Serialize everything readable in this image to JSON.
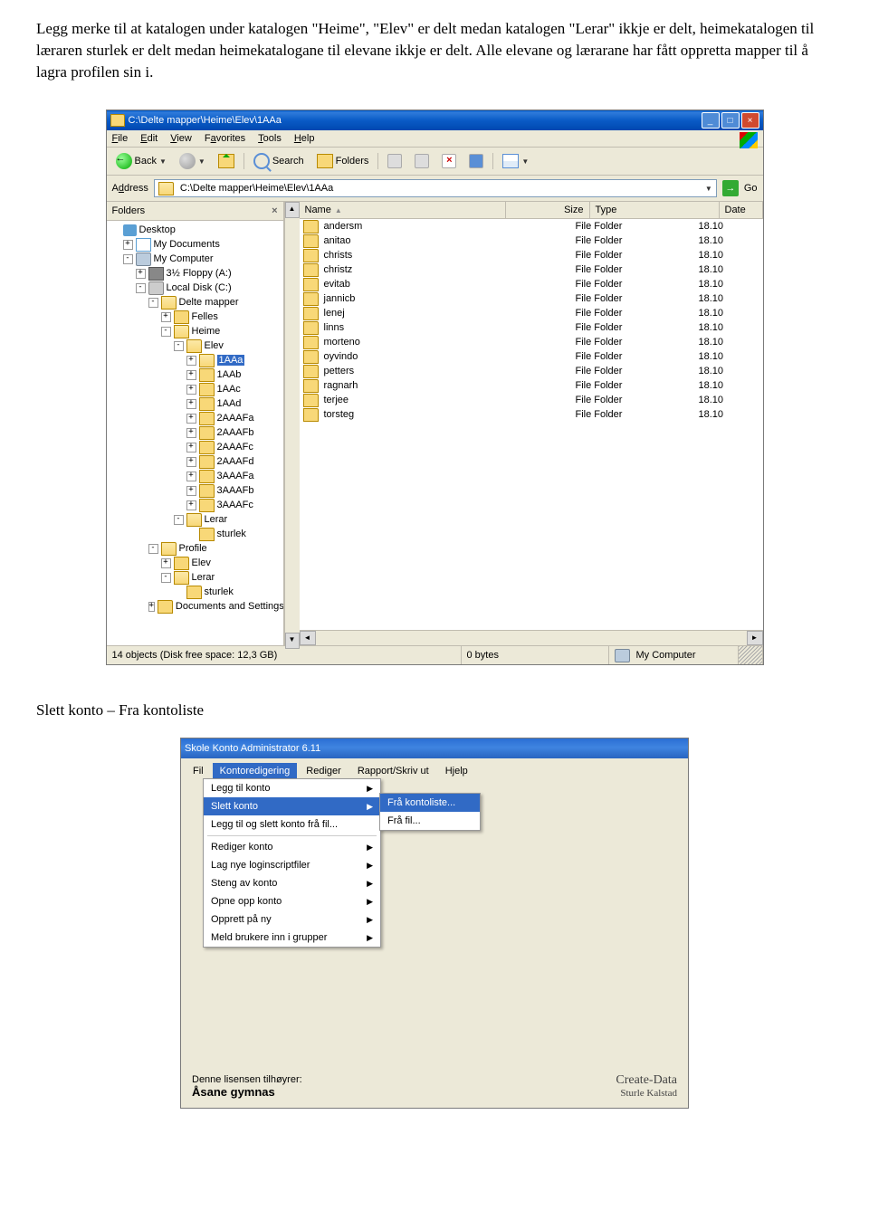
{
  "doc": {
    "para": "Legg merke til at katalogen under katalogen \"Heime\", \"Elev\" er delt medan katalogen \"Lerar\" ikkje er delt, heimekatalogen til læraren sturlek er delt medan heimekatalogane til elevane ikkje er delt. Alle elevane og lærarane har fått oppretta mapper til å lagra profilen sin i.",
    "section": "Slett konto – Fra kontoliste"
  },
  "explorer": {
    "title": "C:\\Delte mapper\\Heime\\Elev\\1AAa",
    "menu": {
      "file": "File",
      "edit": "Edit",
      "view": "View",
      "fav": "Favorites",
      "tools": "Tools",
      "help": "Help"
    },
    "tb": {
      "back": "Back",
      "search": "Search",
      "folders": "Folders"
    },
    "addr": {
      "label": "Address",
      "path": "C:\\Delte mapper\\Heime\\Elev\\1AAa",
      "go": "Go"
    },
    "paneTitle": "Folders",
    "tree": [
      {
        "ind": 0,
        "exp": "",
        "icon": "desktop",
        "label": "Desktop"
      },
      {
        "ind": 1,
        "exp": "+",
        "icon": "mydocs",
        "label": "My Documents"
      },
      {
        "ind": 1,
        "exp": "-",
        "icon": "mycomp",
        "label": "My Computer"
      },
      {
        "ind": 2,
        "exp": "+",
        "icon": "floppy",
        "label": "3½ Floppy (A:)"
      },
      {
        "ind": 2,
        "exp": "-",
        "icon": "disk",
        "label": "Local Disk (C:)"
      },
      {
        "ind": 3,
        "exp": "-",
        "icon": "folder open",
        "label": "Delte mapper"
      },
      {
        "ind": 4,
        "exp": "+",
        "icon": "folder",
        "label": "Felles"
      },
      {
        "ind": 4,
        "exp": "-",
        "icon": "folder open",
        "label": "Heime"
      },
      {
        "ind": 5,
        "exp": "-",
        "icon": "folder open",
        "label": "Elev"
      },
      {
        "ind": 6,
        "exp": "+",
        "icon": "folder open",
        "label": "1AAa",
        "sel": true
      },
      {
        "ind": 6,
        "exp": "+",
        "icon": "folder",
        "label": "1AAb"
      },
      {
        "ind": 6,
        "exp": "+",
        "icon": "folder",
        "label": "1AAc"
      },
      {
        "ind": 6,
        "exp": "+",
        "icon": "folder",
        "label": "1AAd"
      },
      {
        "ind": 6,
        "exp": "+",
        "icon": "folder",
        "label": "2AAAFa"
      },
      {
        "ind": 6,
        "exp": "+",
        "icon": "folder",
        "label": "2AAAFb"
      },
      {
        "ind": 6,
        "exp": "+",
        "icon": "folder",
        "label": "2AAAFc"
      },
      {
        "ind": 6,
        "exp": "+",
        "icon": "folder",
        "label": "2AAAFd"
      },
      {
        "ind": 6,
        "exp": "+",
        "icon": "folder",
        "label": "3AAAFa"
      },
      {
        "ind": 6,
        "exp": "+",
        "icon": "folder",
        "label": "3AAAFb"
      },
      {
        "ind": 6,
        "exp": "+",
        "icon": "folder",
        "label": "3AAAFc"
      },
      {
        "ind": 5,
        "exp": "-",
        "icon": "folder open",
        "label": "Lerar"
      },
      {
        "ind": 6,
        "exp": "",
        "icon": "folder",
        "label": "sturlek"
      },
      {
        "ind": 3,
        "exp": "-",
        "icon": "folder open",
        "label": "Profile"
      },
      {
        "ind": 4,
        "exp": "+",
        "icon": "folder",
        "label": "Elev"
      },
      {
        "ind": 4,
        "exp": "-",
        "icon": "folder open",
        "label": "Lerar"
      },
      {
        "ind": 5,
        "exp": "",
        "icon": "folder",
        "label": "sturlek"
      },
      {
        "ind": 3,
        "exp": "+",
        "icon": "folder",
        "label": "Documents and Settings"
      }
    ],
    "cols": {
      "name": "Name",
      "size": "Size",
      "type": "Type",
      "date": "Date"
    },
    "files": [
      {
        "name": "andersm",
        "type": "File Folder",
        "date": "18.10"
      },
      {
        "name": "anitao",
        "type": "File Folder",
        "date": "18.10"
      },
      {
        "name": "christs",
        "type": "File Folder",
        "date": "18.10"
      },
      {
        "name": "christz",
        "type": "File Folder",
        "date": "18.10"
      },
      {
        "name": "evitab",
        "type": "File Folder",
        "date": "18.10"
      },
      {
        "name": "jannicb",
        "type": "File Folder",
        "date": "18.10"
      },
      {
        "name": "lenej",
        "type": "File Folder",
        "date": "18.10"
      },
      {
        "name": "linns",
        "type": "File Folder",
        "date": "18.10"
      },
      {
        "name": "morteno",
        "type": "File Folder",
        "date": "18.10"
      },
      {
        "name": "oyvindo",
        "type": "File Folder",
        "date": "18.10"
      },
      {
        "name": "petters",
        "type": "File Folder",
        "date": "18.10"
      },
      {
        "name": "ragnarh",
        "type": "File Folder",
        "date": "18.10"
      },
      {
        "name": "terjee",
        "type": "File Folder",
        "date": "18.10"
      },
      {
        "name": "torsteg",
        "type": "File Folder",
        "date": "18.10"
      }
    ],
    "status": {
      "s1": "14 objects (Disk free space: 12,3 GB)",
      "s2": "0 bytes",
      "s3": "My Computer"
    }
  },
  "ska": {
    "title": "Skole Konto Administrator 6.11",
    "menu": {
      "fil": "Fil",
      "kontor": "Kontoredigering",
      "rediger": "Rediger",
      "rapport": "Rapport/Skriv ut",
      "hjelp": "Hjelp"
    },
    "dd": [
      {
        "label": "Legg til konto",
        "arrow": true
      },
      {
        "label": "Slett konto",
        "arrow": true,
        "sel": true
      },
      {
        "label": "Legg til og slett konto frå fil..."
      },
      {
        "sep": true
      },
      {
        "label": "Rediger konto",
        "arrow": true
      },
      {
        "label": "Lag nye loginscriptfiler",
        "arrow": true
      },
      {
        "label": "Steng av konto",
        "arrow": true
      },
      {
        "label": "Opne opp konto",
        "arrow": true
      },
      {
        "label": "Opprett på ny",
        "arrow": true
      },
      {
        "label": "Meld brukere inn i grupper",
        "arrow": true
      }
    ],
    "sub": [
      {
        "label": "Frå kontoliste...",
        "sel": true
      },
      {
        "label": "Frå fil..."
      }
    ],
    "footer": {
      "lic": "Denne lisensen tilhøyrer:",
      "owner": "Åsane gymnas",
      "brand": "Create-Data",
      "brandsub": "Sturle Kalstad"
    }
  }
}
